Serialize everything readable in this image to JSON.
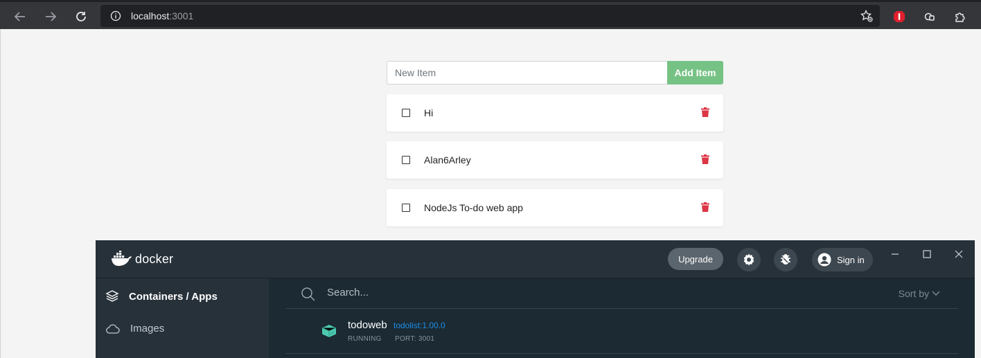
{
  "browser": {
    "url_host": "localhost",
    "url_port": ":3001",
    "icons": [
      "back-arrow-icon",
      "forward-arrow-icon",
      "reload-icon",
      "info-icon",
      "bookmark-star-icon",
      "adblock-icon",
      "extension-icon",
      "puzzle-icon"
    ]
  },
  "todo": {
    "input_placeholder": "New Item",
    "add_button_label": "Add Item",
    "items": [
      {
        "label": "Hi",
        "checked": false
      },
      {
        "label": "Alan6Arley",
        "checked": false
      },
      {
        "label": "NodeJs To-do web app",
        "checked": false
      }
    ],
    "accent_color": "#76c285",
    "delete_color": "#dc3545"
  },
  "docker": {
    "brand": "docker",
    "upgrade_label": "Upgrade",
    "signin_label": "Sign in",
    "sidebar": [
      {
        "label": "Containers / Apps",
        "active": true,
        "icon": "container-stack-icon"
      },
      {
        "label": "Images",
        "active": false,
        "icon": "cloud-icon"
      }
    ],
    "search_placeholder": "Search...",
    "sort_label": "Sort by",
    "containers": [
      {
        "name": "todoweb",
        "image": "todolist:1.00.0",
        "status": "RUNNING",
        "port": "PORT: 3001"
      }
    ],
    "colors": {
      "header": "#27313a",
      "main": "#1b2a33",
      "running": "#4ec9b0",
      "link": "#1d8ee9"
    }
  }
}
